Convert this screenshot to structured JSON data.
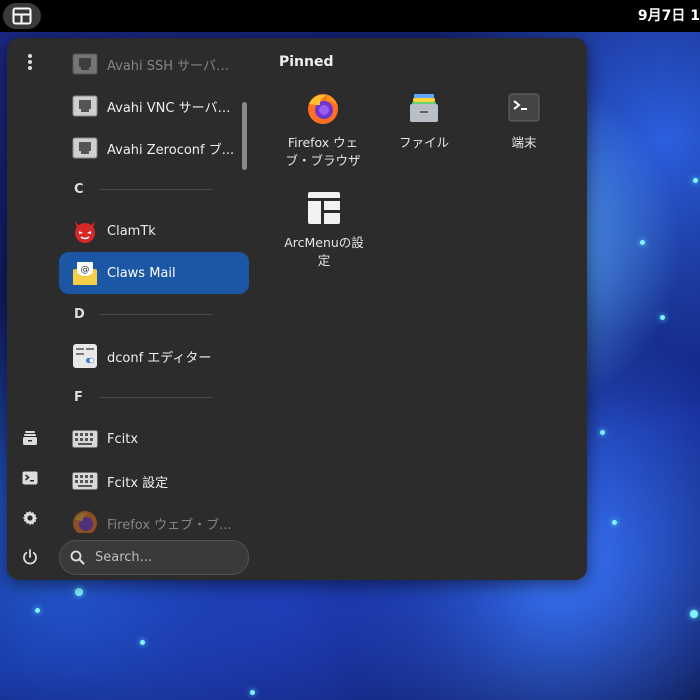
{
  "topbar": {
    "clock": "9月7日 1",
    "activities_icon": "grid-layout-icon"
  },
  "side_buttons": [
    {
      "name": "more-options-button",
      "icon": "vertical-dots-icon"
    },
    {
      "name": "files-button",
      "icon": "drawer-icon"
    },
    {
      "name": "terminal-button",
      "icon": "terminal-icon"
    },
    {
      "name": "settings-button",
      "icon": "gear-icon"
    },
    {
      "name": "power-button",
      "icon": "power-icon"
    }
  ],
  "app_list": {
    "items": [
      {
        "label": "Avahi SSH サーバの...",
        "icon": "network-icon"
      },
      {
        "label": "Avahi VNC サーバの...",
        "icon": "network-icon"
      },
      {
        "label": "Avahi Zeroconf ブ...",
        "icon": "network-icon"
      },
      {
        "label": "ClamTk",
        "icon": "clamtk-devil-icon"
      },
      {
        "label": "Claws Mail",
        "icon": "mail-envelope-icon"
      },
      {
        "label": "dconf エディター",
        "icon": "dconf-icon"
      },
      {
        "label": "Fcitx",
        "icon": "keyboard-icon"
      },
      {
        "label": "Fcitx 設定",
        "icon": "keyboard-icon"
      },
      {
        "label": "Firefox ウェブ・ブ...",
        "icon": "firefox-icon"
      }
    ],
    "sections": [
      "C",
      "D",
      "F"
    ]
  },
  "search": {
    "placeholder": "Search..."
  },
  "pinned": {
    "title": "Pinned",
    "tiles": [
      {
        "label": "Firefox ウェブ・ブラウザ",
        "icon": "firefox-icon"
      },
      {
        "label": "ファイル",
        "icon": "files-drawer-icon"
      },
      {
        "label": "端末",
        "icon": "terminal-icon"
      },
      {
        "label": "ArcMenuの設定",
        "icon": "arcmenu-settings-icon"
      }
    ]
  }
}
